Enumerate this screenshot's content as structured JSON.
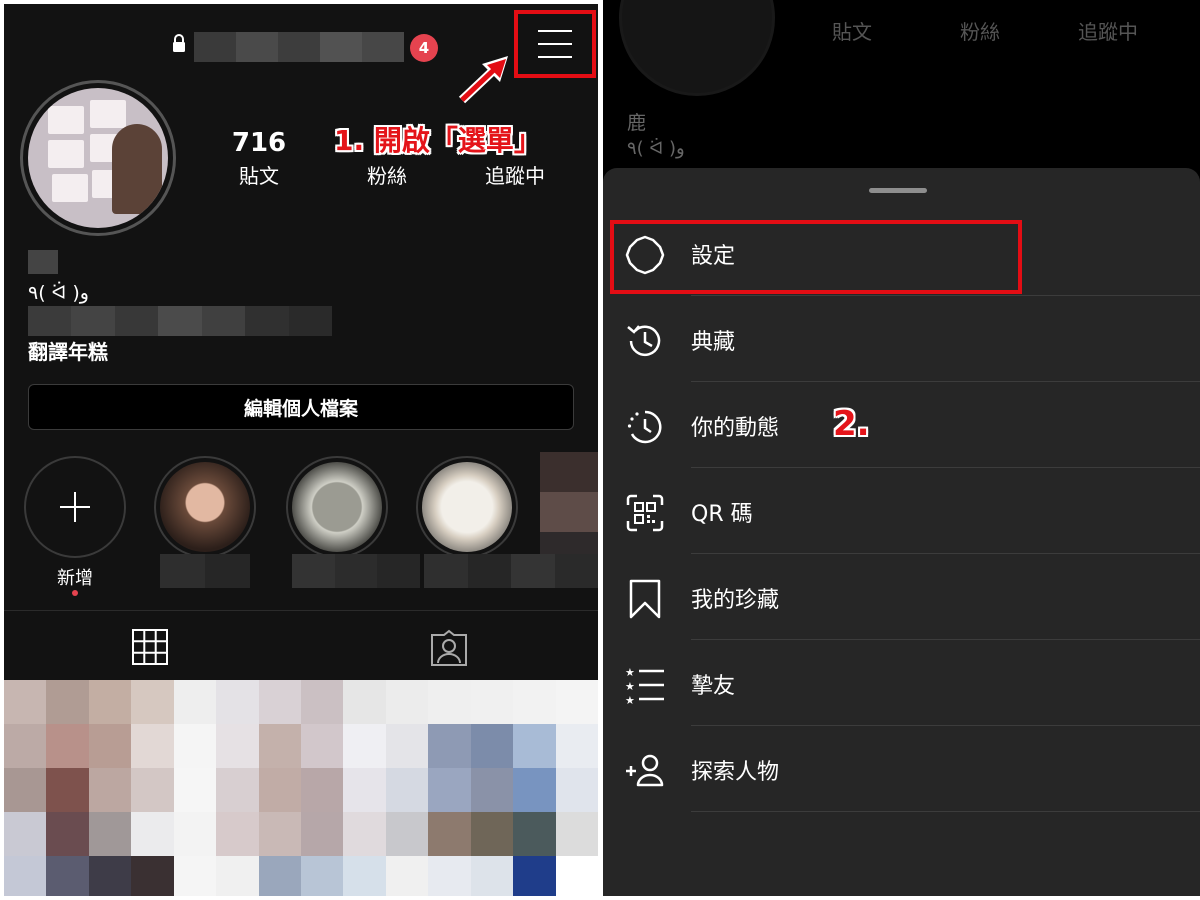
{
  "left_panel": {
    "header": {
      "notification_count": "4"
    },
    "annotation_step1": "1. 開啟「選單」",
    "stats": {
      "posts": {
        "value": "716",
        "label": "貼文"
      },
      "followers": {
        "value": "",
        "label": "粉絲"
      },
      "following": {
        "value": "",
        "label": "追蹤中"
      }
    },
    "bio": {
      "line1": "٩( ᐛ )و",
      "line2": "翻譯年糕"
    },
    "edit_profile_label": "編輯個人檔案",
    "highlights": {
      "new_label": "新增"
    }
  },
  "right_panel": {
    "behind": {
      "stats_labels": [
        "貼文",
        "粉絲",
        "追蹤中"
      ],
      "name": "鹿",
      "bio": "٩( ᐛ )و"
    },
    "annotation_step2": "2.",
    "menu": [
      {
        "icon": "gear-icon",
        "label": "設定"
      },
      {
        "icon": "archive-icon",
        "label": "典藏"
      },
      {
        "icon": "activity-icon",
        "label": "你的動態"
      },
      {
        "icon": "qr-code-icon",
        "label": "QR 碼"
      },
      {
        "icon": "bookmark-icon",
        "label": "我的珍藏"
      },
      {
        "icon": "close-friends-icon",
        "label": "摯友"
      },
      {
        "icon": "discover-people-icon",
        "label": "探索人物"
      }
    ]
  },
  "colors": {
    "annotation_red": "#e30d14",
    "badge_red": "#e5434f",
    "sheet_bg": "#262626",
    "page_bg": "#121212"
  }
}
